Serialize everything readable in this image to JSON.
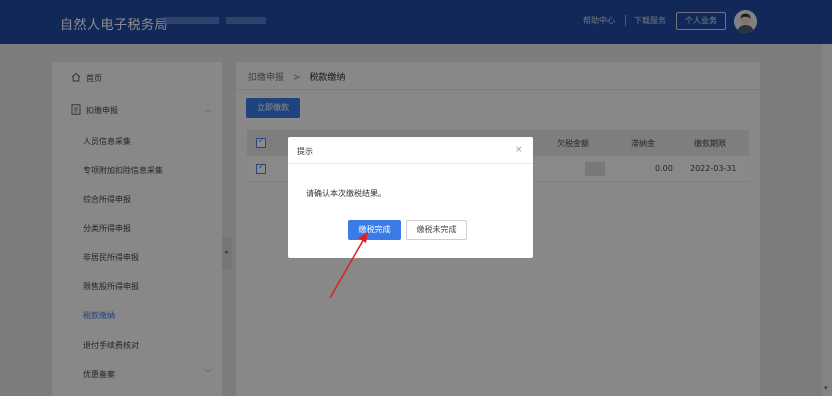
{
  "header": {
    "title": "自然人电子税务局",
    "help": "帮助中心",
    "download": "下载服务",
    "personal": "个人业务"
  },
  "sidebar": {
    "items": [
      {
        "label": "首页"
      },
      {
        "label": "扣缴申报"
      },
      {
        "label": "人员信息采集"
      },
      {
        "label": "专项附加扣除信息采集"
      },
      {
        "label": "综合所得申报"
      },
      {
        "label": "分类所得申报"
      },
      {
        "label": "非居民所得申报"
      },
      {
        "label": "限售股所得申报"
      },
      {
        "label": "税款缴纳"
      },
      {
        "label": "退付手续费核对"
      },
      {
        "label": "优惠备案"
      }
    ],
    "active_color": "#3b7be6"
  },
  "main": {
    "breadcrumb": {
      "parent": "扣缴申报",
      "sep": ">",
      "current": "税款缴纳"
    },
    "pay_now": "立即缴款",
    "table": {
      "headers": [
        "欠税金额",
        "滞纳金",
        "缴款期限"
      ],
      "rows": [
        {
          "overdue": "",
          "late_fee": "0.00",
          "deadline": "2022-03-31"
        }
      ]
    }
  },
  "dialog": {
    "title": "提示",
    "close": "×",
    "message": "请确认本次缴税结果。",
    "confirm": "缴税完成",
    "cancel": "缴税未完成"
  },
  "colors": {
    "header": "#1f4aa0",
    "primary": "#3b7be6",
    "arrow": "#e02020"
  }
}
